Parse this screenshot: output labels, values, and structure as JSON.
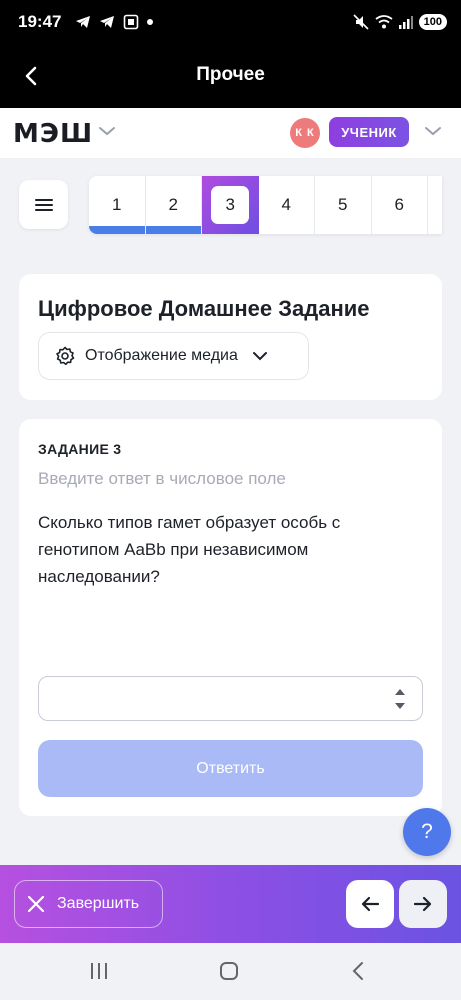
{
  "status_bar": {
    "time": "19:47",
    "battery": "100"
  },
  "app_bar": {
    "title": "Прочее"
  },
  "header": {
    "logo": "МЭШ",
    "avatar_initials": "К К",
    "role": "УЧЕНИК"
  },
  "task_nav": {
    "tabs": [
      "1",
      "2",
      "3",
      "4",
      "5",
      "6"
    ],
    "active": "3"
  },
  "homework": {
    "title": "Цифровое Домашнее Задание",
    "media_button": "Отображение медиа"
  },
  "task": {
    "label": "ЗАДАНИЕ 3",
    "hint": "Введите ответ в числовое поле",
    "question": "Сколько типов гамет образует особь с генотипом AaBb при независимом наследовании?",
    "answer_value": "",
    "submit_label": "Ответить"
  },
  "help": {
    "label": "?"
  },
  "bottom_bar": {
    "finish_label": "Завершить"
  },
  "colors": {
    "accent_blue": "#4a7de8",
    "accent_purple": "#8f3ee0",
    "submit_disabled": "#a9baf7"
  }
}
